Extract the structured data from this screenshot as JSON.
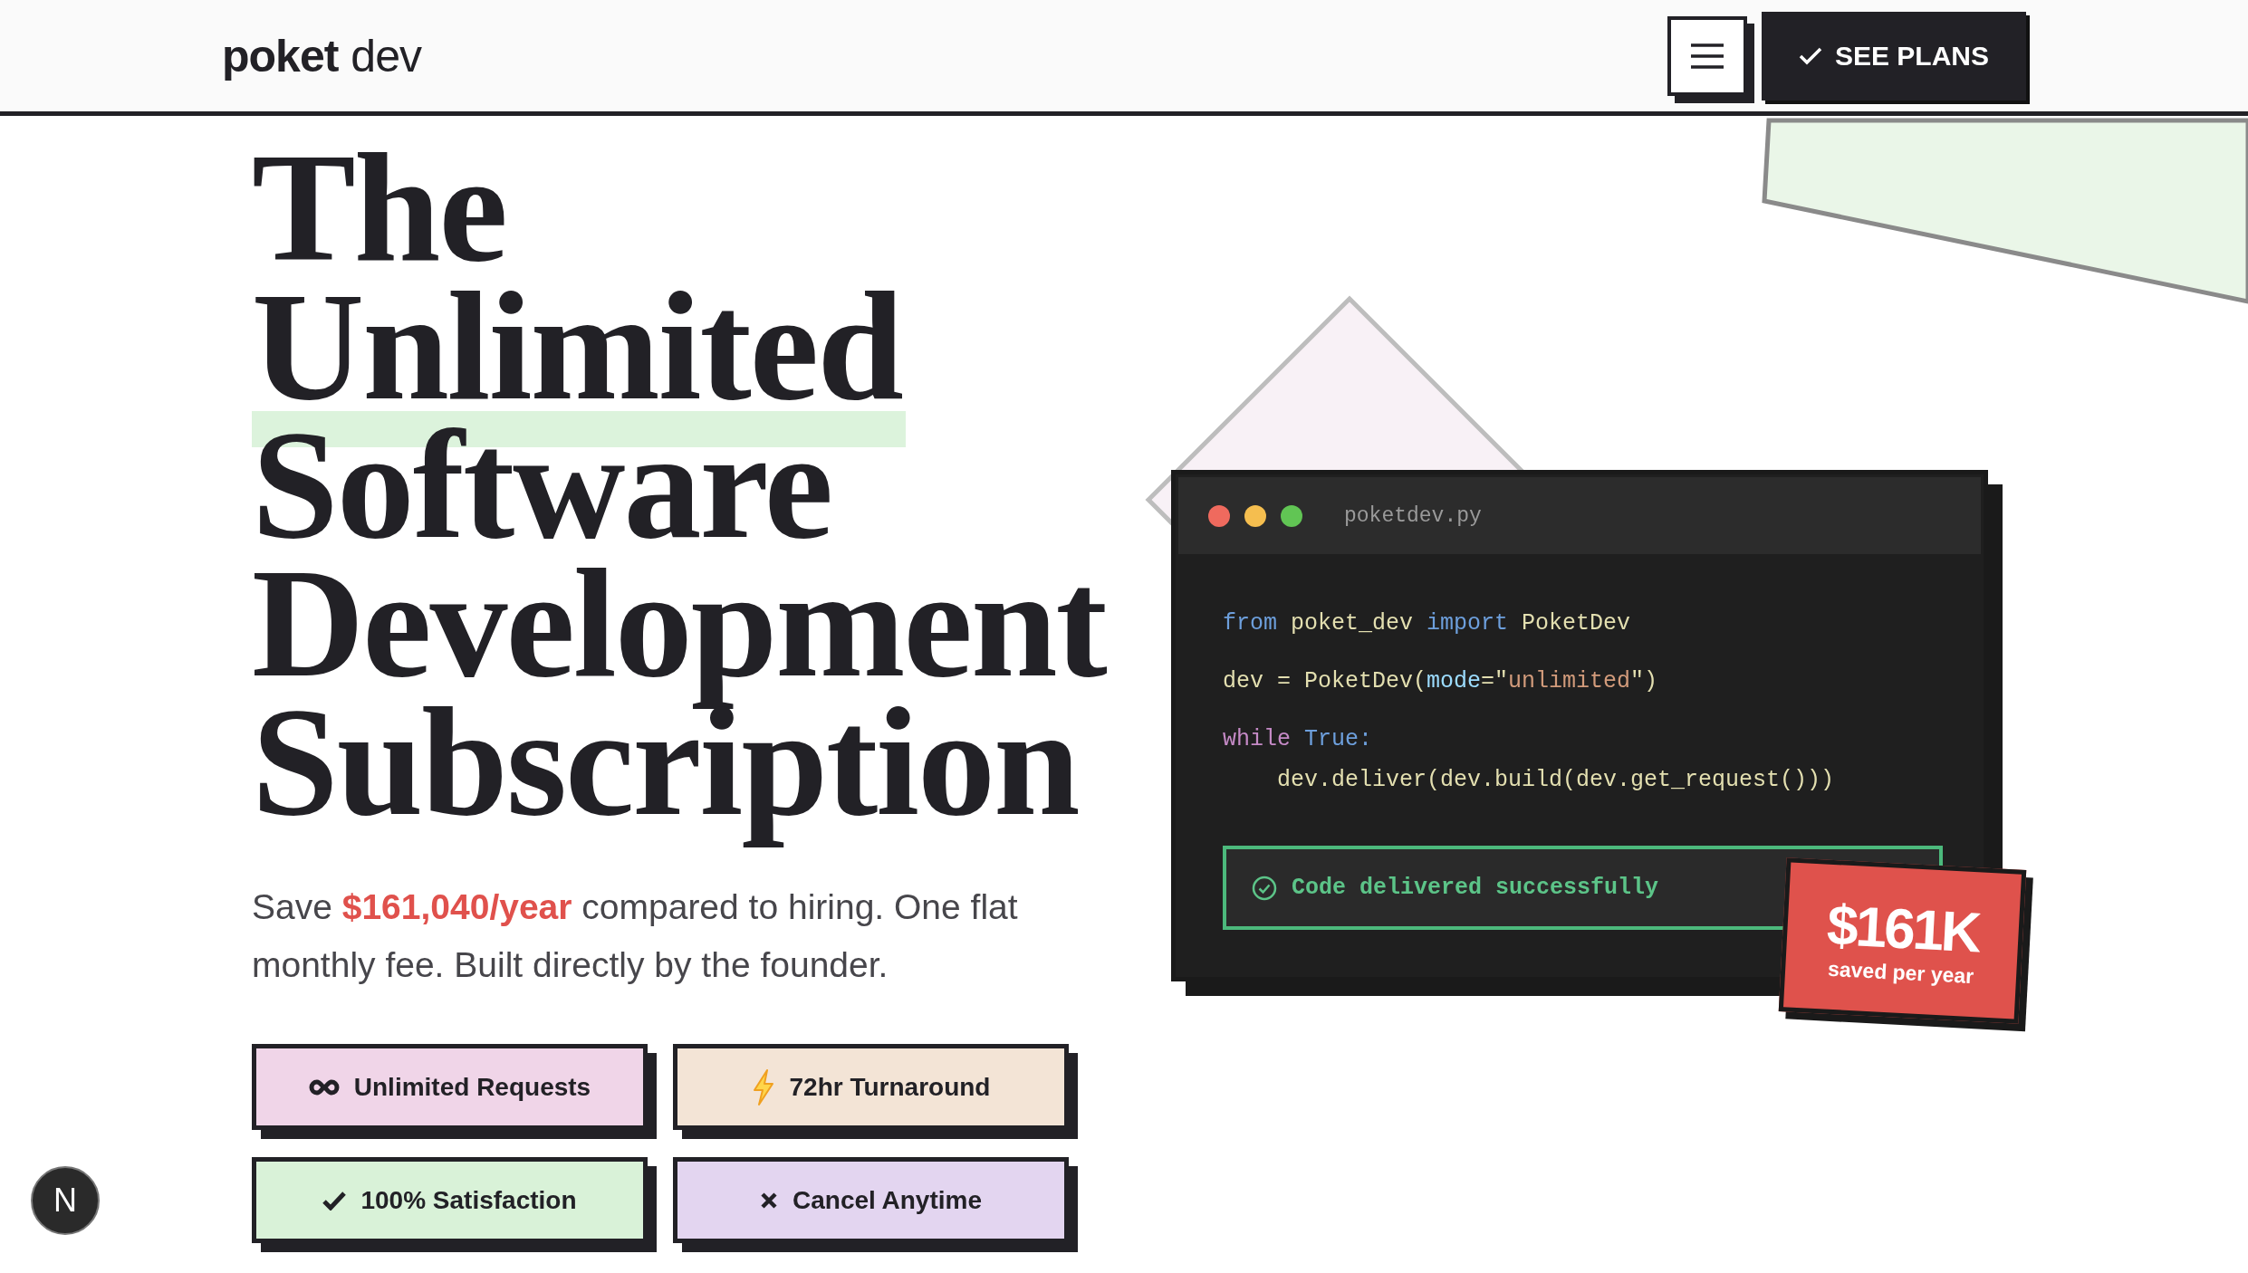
{
  "header": {
    "logo": {
      "bold": "poket",
      "light": "dev"
    },
    "cta": {
      "label": "SEE PLANS"
    }
  },
  "hero": {
    "title_lines": [
      {
        "text": "The",
        "highlighted": false
      },
      {
        "text": "Unlimited",
        "highlighted": true
      },
      {
        "text": "Software",
        "highlighted": false
      },
      {
        "text": "Development",
        "highlighted": false
      },
      {
        "text": "Subscription",
        "highlighted": false
      }
    ],
    "subtitle": "Save **$161,040/year** compared to hiring. One flat monthly fee. Built directly by the founder.",
    "features": [
      {
        "label": "Unlimited Requests",
        "kind": "infinity",
        "color": "#f0d5e8"
      },
      {
        "label": "72hr Turnaround",
        "kind": "bolt",
        "color": "#f3e4d6"
      },
      {
        "label": "100% Satisfaction",
        "kind": "check",
        "color": "#d9f2d8"
      },
      {
        "label": "Cancel Anytime",
        "kind": "cross",
        "color": "#e3d5f0"
      }
    ]
  },
  "code_window": {
    "filename": "poketdev.py",
    "blocks": [
      [
        [
          {
            "text": "from",
            "kind": "keyword"
          },
          {
            "text": " poket_dev ",
            "kind": "name"
          },
          {
            "text": "import",
            "kind": "keyword"
          },
          {
            "text": " PoketDev",
            "kind": "name"
          }
        ]
      ],
      [
        [
          {
            "text": "dev = PoketDev(",
            "kind": "name"
          },
          {
            "text": "mode",
            "kind": "param"
          },
          {
            "text": "=\"",
            "kind": "name"
          },
          {
            "text": "unlimited",
            "kind": "string"
          },
          {
            "text": "\")",
            "kind": "name"
          }
        ]
      ],
      [
        [
          {
            "text": "while ",
            "kind": "control"
          },
          {
            "text": "True:",
            "kind": "keyword"
          }
        ],
        [
          {
            "text": "    dev.deliver(dev.build(dev.get_request()))",
            "kind": "name"
          }
        ]
      ]
    ],
    "status": "Code delivered successfully"
  },
  "badge": {
    "amount": "$161K",
    "caption": "saved per year"
  },
  "dev_indicator": {
    "label": "N"
  }
}
